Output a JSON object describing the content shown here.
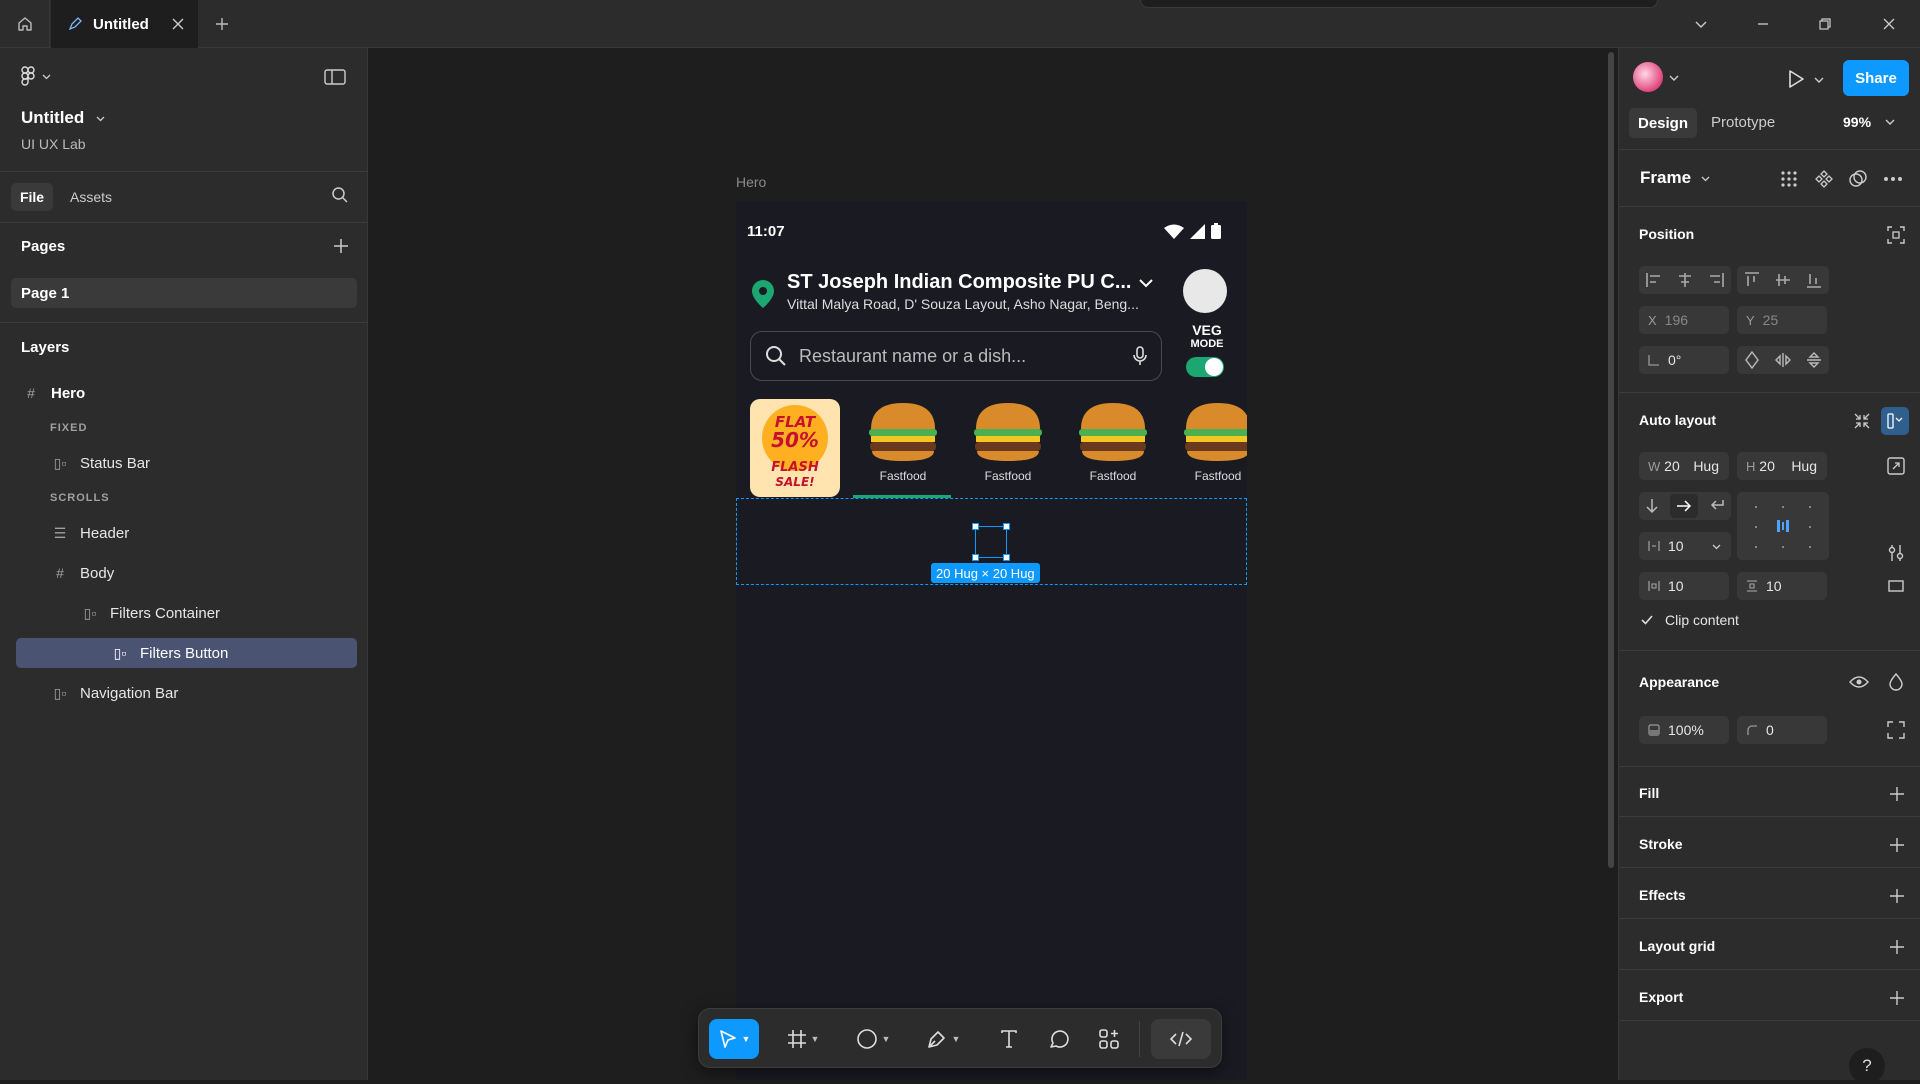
{
  "app": {
    "tab_title": "Untitled",
    "file_name": "Untitled",
    "team_name": "UI UX Lab"
  },
  "left_panel": {
    "tabs": [
      "File",
      "Assets"
    ],
    "pages_label": "Pages",
    "pages": [
      "Page 1"
    ],
    "layers_label": "Layers",
    "layers": [
      {
        "name": "Hero",
        "icon": "frame-icon"
      },
      {
        "section": "FIXED"
      },
      {
        "name": "Status Bar",
        "icon": "auto-layout-icon"
      },
      {
        "section": "SCROLLS"
      },
      {
        "name": "Header",
        "icon": "stack-icon"
      },
      {
        "name": "Body",
        "icon": "frame-icon"
      },
      {
        "name": "Filters Container",
        "icon": "auto-layout-icon"
      },
      {
        "name": "Filters Button",
        "icon": "auto-layout-icon",
        "selected": true
      },
      {
        "name": "Navigation Bar",
        "icon": "auto-layout-icon"
      }
    ]
  },
  "canvas": {
    "frame_label": "Hero",
    "selection_label": "20 Hug × 20 Hug",
    "phone": {
      "time": "11:07",
      "location_title": "ST Joseph Indian Composite PU C...",
      "location_subtitle": "Vittal Malya Road, D' Souza Layout, Asho Nagar, Beng...",
      "veg_mode_line1": "VEG",
      "veg_mode_line2": "MODE",
      "search_placeholder": "Restaurant name or a dish...",
      "promo_line1": "FLAT",
      "promo_line2": "50%",
      "promo_line3": "FLASH",
      "promo_line4": "SALE!",
      "categories": [
        "Fastfood",
        "Fastfood",
        "Fastfood",
        "Fastfood"
      ]
    }
  },
  "right_panel": {
    "share_label": "Share",
    "tabs": [
      "Design",
      "Prototype"
    ],
    "zoom": "99%",
    "frame_type": "Frame",
    "position": {
      "label": "Position",
      "x_label": "X",
      "x": "196",
      "y_label": "Y",
      "y": "25",
      "rotation": "0°"
    },
    "auto_layout": {
      "label": "Auto layout",
      "w_label": "W",
      "w": "20",
      "w_mode": "Hug",
      "h_label": "H",
      "h": "20",
      "h_mode": "Hug",
      "gap": "10",
      "padding_h": "10",
      "padding_v": "10",
      "clip_label": "Clip content"
    },
    "appearance": {
      "label": "Appearance",
      "opacity": "100%",
      "radius": "0"
    },
    "sections": [
      "Fill",
      "Stroke",
      "Effects",
      "Layout grid",
      "Export"
    ],
    "help": "?"
  },
  "colors": {
    "accent": "#0d99ff",
    "selected_layer": "#4a5372",
    "veg_green": "#1ba672"
  }
}
